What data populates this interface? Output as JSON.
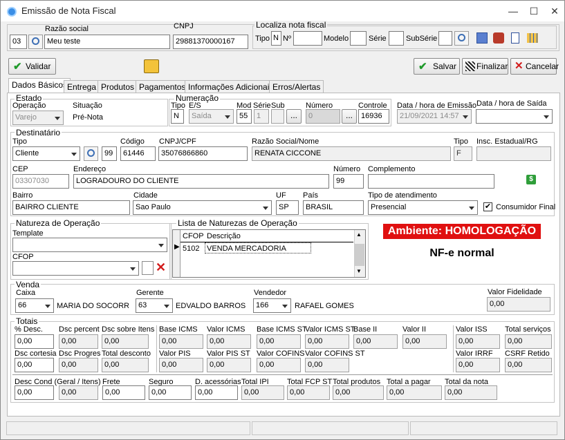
{
  "window": {
    "title": "Emissão de Nota Fiscal",
    "minimize": "—",
    "maximize": "☐",
    "close": "✕"
  },
  "header": {
    "razao_label": "Razão social",
    "cnpj_label": "CNPJ",
    "code": "03",
    "razao": "Meu teste",
    "cnpj": "29881370000167",
    "localiza": {
      "title": "Localiza nota fiscal",
      "tipo_label": "Tipo",
      "tipo": "N",
      "no_label": "Nº",
      "modelo_label": "Modelo",
      "serie_label": "Série",
      "subserie_label": "SubSérie"
    }
  },
  "toolbar": {
    "validar": "Validar",
    "salvar": "Salvar",
    "finalizar": "Finalizar",
    "cancelar": "Cancelar"
  },
  "tabs": [
    "Dados Básicos",
    "Entrega",
    "Produtos",
    "Pagamentos",
    "Informações Adicionais",
    "Erros/Alertas"
  ],
  "estado": {
    "title": "Estado",
    "operacao_label": "Operação",
    "operacao": "Varejo",
    "situacao_label": "Situação",
    "situacao": "Pré-Nota"
  },
  "numeracao": {
    "title": "Numeração",
    "tipo_label": "Tipo",
    "tipo": "N",
    "es_label": "E/S",
    "es": "Saída",
    "mod_label": "Mod",
    "mod": "55",
    "serie_label": "Série",
    "serie": "1",
    "sub_label": "Sub",
    "numero_label": "Número",
    "numero": "0",
    "controle_label": "Controle",
    "controle": "16936",
    "ellipsis": "..."
  },
  "emissao": {
    "label": "Data / hora de Emissão",
    "value": "21/09/2021 14:57",
    "saida_label": "Data / hora de Saída",
    "saida": ""
  },
  "destinatario": {
    "title": "Destinatário",
    "tipo_label": "Tipo",
    "tipo": "Cliente",
    "num": "99",
    "codigo_label": "Código",
    "codigo": "61446",
    "cnpj_label": "CNPJ/CPF",
    "cnpj": "35076866860",
    "razao_label": "Razão Social/Nome",
    "razao": "RENATA CICCONE",
    "tipo2_label": "Tipo",
    "tipo2": "F",
    "ie_label": "Insc. Estadual/RG",
    "ie": "",
    "cep_label": "CEP",
    "cep": "03307030",
    "endereco_label": "Endereço",
    "endereco": "LOGRADOURO DO CLIENTE",
    "numero_label": "Número",
    "numero": "99",
    "complemento_label": "Complemento",
    "complemento": "",
    "bairro_label": "Bairro",
    "bairro": "BAIRRO CLIENTE",
    "cidade_label": "Cidade",
    "cidade": "Sao Paulo",
    "uf_label": "UF",
    "uf": "SP",
    "pais_label": "País",
    "pais": "BRASIL",
    "atend_label": "Tipo de atendimento",
    "atend": "Presencial",
    "consumidor_label": "Consumidor Final"
  },
  "natureza": {
    "title": "Natureza de Operação",
    "template_label": "Template",
    "cfop_label": "CFOP",
    "list_title": "Lista de Naturezas de Operação",
    "col_cfop": "CFOP",
    "col_desc": "Descrição",
    "row_cfop": "5102",
    "row_desc": "VENDA MERCADORIA"
  },
  "ambiente": {
    "badge": "Ambiente: HOMOLOGAÇÃO",
    "tipo": "NF-e normal",
    "badge_color": "#e01010"
  },
  "venda": {
    "title": "Venda",
    "caixa_label": "Caixa",
    "caixa": "66",
    "caixa_nome": "MARIA DO SOCORRO",
    "gerente_label": "Gerente",
    "gerente": "63",
    "gerente_nome": "EDVALDO BARROS",
    "vendedor_label": "Vendedor",
    "vendedor": "166",
    "vendedor_nome": "RAFAEL GOMES",
    "fidelidade_label": "Valor Fidelidade",
    "fidelidade": "0,00"
  },
  "totais": {
    "title": "Totais",
    "row1": [
      {
        "l": "% Desc.",
        "v": "0,00"
      },
      {
        "l": "Dsc percent",
        "v": "0,00"
      },
      {
        "l": "Dsc sobre Itens",
        "v": "0,00"
      },
      {
        "l": "Base ICMS",
        "v": "0,00"
      },
      {
        "l": "Valor ICMS",
        "v": "0,00"
      },
      {
        "l": "Base ICMS ST",
        "v": "0,00"
      },
      {
        "l": "Valor ICMS ST",
        "v": "0,00"
      },
      {
        "l": "Base II",
        "v": "0,00"
      },
      {
        "l": "Valor II",
        "v": "0,00"
      },
      {
        "l": "Valor ISS",
        "v": "0,00"
      },
      {
        "l": "Total serviços",
        "v": "0,00"
      }
    ],
    "row2": [
      {
        "l": "Dsc cortesia",
        "v": "0,00"
      },
      {
        "l": "Dsc Progres",
        "v": "0,00"
      },
      {
        "l": "Total desconto",
        "v": "0,00"
      },
      {
        "l": "Valor PIS",
        "v": "0,00"
      },
      {
        "l": "Valor PIS ST",
        "v": "0,00"
      },
      {
        "l": "Valor COFINS",
        "v": "0,00"
      },
      {
        "l": "Valor COFINS ST",
        "v": "0,00"
      },
      {
        "l": "Valor IRRF",
        "v": "0,00"
      },
      {
        "l": "CSRF Retido",
        "v": "0,00"
      }
    ],
    "row3": [
      {
        "l": "Desc Cond (Geral / Itens)",
        "v": "0,00"
      },
      {
        "l": "",
        "v": "0,00"
      },
      {
        "l": "Frete",
        "v": "0,00"
      },
      {
        "l": "Seguro",
        "v": "0,00"
      },
      {
        "l": "D. acessórias",
        "v": "0,00"
      },
      {
        "l": "Total IPI",
        "v": "0,00"
      },
      {
        "l": "Total FCP ST",
        "v": "0,00"
      },
      {
        "l": "Total produtos",
        "v": "0,00"
      },
      {
        "l": "Total a pagar",
        "v": "0,00"
      },
      {
        "l": "Total da nota",
        "v": "0,00"
      }
    ]
  }
}
